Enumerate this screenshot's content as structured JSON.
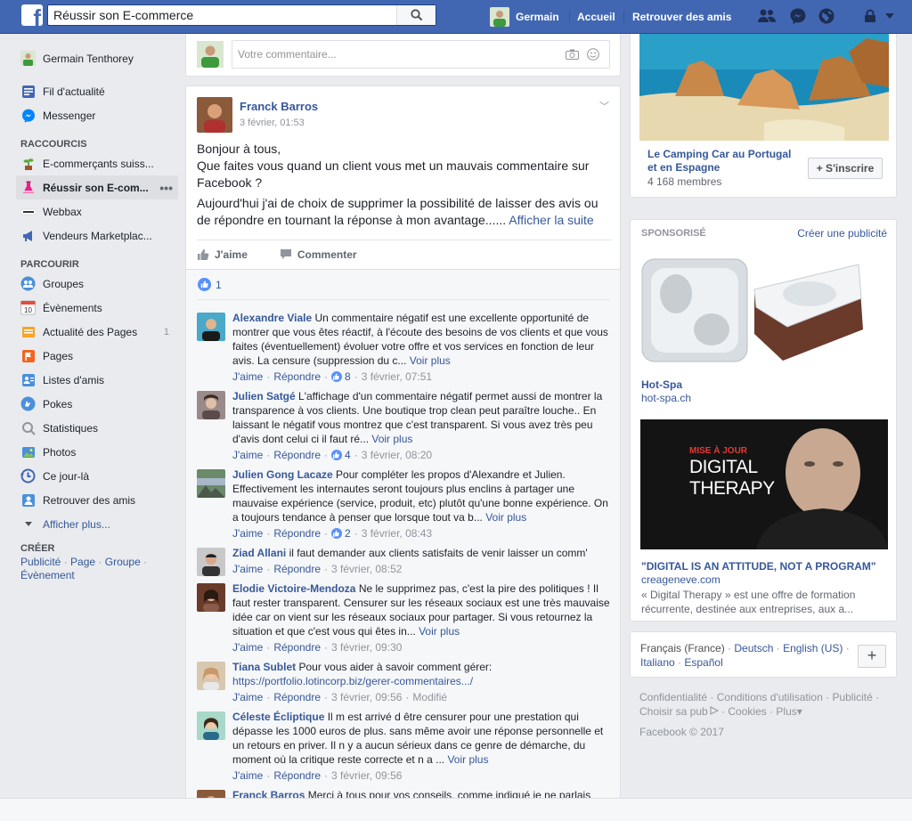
{
  "colors": {
    "brand": "#4267b2",
    "link": "#365899",
    "background": "#e9ebee"
  },
  "topbar": {
    "search_value": "Réussir son E-commerce",
    "profile_name": "Germain",
    "home": "Accueil",
    "find_friends": "Retrouver des amis",
    "icons": [
      "friend-requests-icon",
      "messenger-icon",
      "notifications-globe-icon",
      "privacy-lock-icon",
      "account-menu-icon"
    ]
  },
  "sidebar": {
    "user": "Germain Tenthorey",
    "top": [
      {
        "label": "Fil d'actualité",
        "icon": "newsfeed-icon"
      },
      {
        "label": "Messenger",
        "icon": "messenger-icon"
      }
    ],
    "shortcuts_header": "RACCOURCIS",
    "shortcuts": [
      {
        "label": "E-commerçants suiss...",
        "icon": "plant-icon"
      },
      {
        "label": "Réussir son E-com...",
        "icon": "flask-icon",
        "active": true,
        "more": "•••"
      },
      {
        "label": "Webbax",
        "icon": "webbax-icon"
      },
      {
        "label": "Vendeurs Marketplac...",
        "icon": "megaphone-icon"
      }
    ],
    "explore_header": "PARCOURIR",
    "explore": [
      {
        "label": "Groupes",
        "icon": "groups-icon"
      },
      {
        "label": "Évènements",
        "icon": "calendar-icon",
        "badge": "10"
      },
      {
        "label": "Actualité des Pages",
        "icon": "pages-feed-icon",
        "count": "1"
      },
      {
        "label": "Pages",
        "icon": "flag-icon"
      },
      {
        "label": "Listes d'amis",
        "icon": "friend-lists-icon"
      },
      {
        "label": "Pokes",
        "icon": "pokes-icon"
      },
      {
        "label": "Statistiques",
        "icon": "statistics-icon"
      },
      {
        "label": "Photos",
        "icon": "photos-icon"
      },
      {
        "label": "Ce jour-là",
        "icon": "on-this-day-icon"
      },
      {
        "label": "Retrouver des amis",
        "icon": "find-friends-icon"
      }
    ],
    "see_more": "Afficher plus...",
    "create_header": "CRÉER",
    "create_links": [
      "Publicité",
      "Page",
      "Groupe",
      "Évènement"
    ]
  },
  "composer": {
    "placeholder": "Votre commentaire..."
  },
  "post": {
    "author": "Franck Barros",
    "date": "3 février, 01:53",
    "body_line1": "Bonjour à tous,",
    "body_line2": "Que faites vous quand un client vous met un mauvais commentaire sur Facebook ?",
    "body_line3": "Aujourd'hui j'ai de choix de supprimer la possibilité de laisser des avis ou de répondre en tournant la réponse à mon avantage......",
    "see_more": "Afficher la suite",
    "like_label": "J'aime",
    "comment_label": "Commenter",
    "likes_count": "1"
  },
  "comments": [
    {
      "name": "Alexandre Viale",
      "text": "Un commentaire négatif est une excellente opportunité de montrer que vous êtes réactif, à l'écoute des besoins de vos clients et que vous faites (éventuellement) évoluer votre offre et vos services en fonction de leur avis. La censure (suppression du c...",
      "see_more": "Voir plus",
      "like": "J'aime",
      "reply": "Répondre",
      "reactions": "8",
      "time": "3 février, 07:51",
      "modified": ""
    },
    {
      "name": "Julien Satgé",
      "text": "L'affichage d'un commentaire négatif permet aussi de montrer la transparence à vos clients. Une boutique trop clean peut paraître louche.. En laissant le négatif vous montrez que c'est transparent. Si vous avez très peu d'avis dont celui ci il faut ré...",
      "see_more": "Voir plus",
      "like": "J'aime",
      "reply": "Répondre",
      "reactions": "4",
      "time": "3 février, 08:20",
      "modified": ""
    },
    {
      "name": "Julien Gong Lacaze",
      "text": "Pour compléter les propos d'Alexandre et Julien. Effectivement les internautes seront toujours plus enclins à partager une mauvaise expérience (service, produit, etc) plutôt qu'une bonne expérience. On a toujours tendance à penser que lorsque tout va b...",
      "see_more": "Voir plus",
      "like": "J'aime",
      "reply": "Répondre",
      "reactions": "2",
      "time": "3 février, 08:43",
      "modified": ""
    },
    {
      "name": "Ziad Allani",
      "text": "il faut demander aux clients satisfaits de venir laisser un comm'",
      "see_more": "",
      "like": "J'aime",
      "reply": "Répondre",
      "reactions": "",
      "time": "3 février, 08:52",
      "modified": ""
    },
    {
      "name": "Elodie Victoire-Mendoza",
      "text": "Ne le supprimez pas, c'est la pire des politiques ! Il faut rester transparent. Censurer sur les réseaux sociaux est une très mauvaise idée car on vient sur les réseaux sociaux pour partager. Si vous retournez la situation et que c'est vous qui êtes in...",
      "see_more": "Voir plus",
      "like": "J'aime",
      "reply": "Répondre",
      "reactions": "",
      "time": "3 février, 09:30",
      "modified": ""
    },
    {
      "name": "Tiana Sublet",
      "text": "Pour vous aider à savoir comment gérer:",
      "link": "https://portfolio.lotincorp.biz/gerer-commentaires.../",
      "see_more": "",
      "like": "J'aime",
      "reply": "Répondre",
      "reactions": "",
      "time": "3 février, 09:56",
      "modified": "Modifié"
    },
    {
      "name": "Céleste Écliptique",
      "text": "Il m est arrivé d être censurer pour une prestation qui dépasse les 1000 euros de plus. sans même avoir une réponse personnelle et un retours en priver. Il n y a aucun sérieux dans ce genre de démarche, du moment où la critique reste correcte et n a ...",
      "see_more": "Voir plus",
      "like": "J'aime",
      "reply": "Répondre",
      "reactions": "",
      "time": "3 février, 09:56",
      "modified": ""
    },
    {
      "name": "Franck Barros",
      "text": "Merci à tous pour vos conseils, comme indiqué je ne parlais",
      "see_more": "",
      "like": "",
      "reply": "",
      "reactions": "",
      "time": "",
      "modified": ""
    }
  ],
  "right": {
    "group": {
      "name": "Le Camping Car au Portugal et en Espagne",
      "members": "4 168 membres",
      "join": "+ S'inscrire"
    },
    "ads": {
      "header": "SPONSORISÉ",
      "create": "Créer une publicité",
      "ad1": {
        "title": "Hot-Spa",
        "url": "hot-spa.ch"
      },
      "ad2": {
        "image_line1": "MISE À JOUR",
        "image_line2": "DIGITAL",
        "image_line3": "THERAPY",
        "title": "\"DIGITAL IS AN ATTITUDE, NOT A PROGRAM\"",
        "url": "creageneve.com",
        "desc": "« Digital Therapy » est une offre de formation récurrente, destinée aux entreprises, aux a..."
      }
    },
    "languages": {
      "current": "Français (France)",
      "others": [
        "Deutsch",
        "English (US)",
        "Italiano",
        "Español"
      ],
      "plus": "+"
    },
    "footer": {
      "links": [
        "Confidentialité",
        "Conditions d'utilisation",
        "Publicité",
        "Choisir sa pub",
        "Cookies",
        "Plus"
      ],
      "copyright": "Facebook © 2017"
    }
  }
}
